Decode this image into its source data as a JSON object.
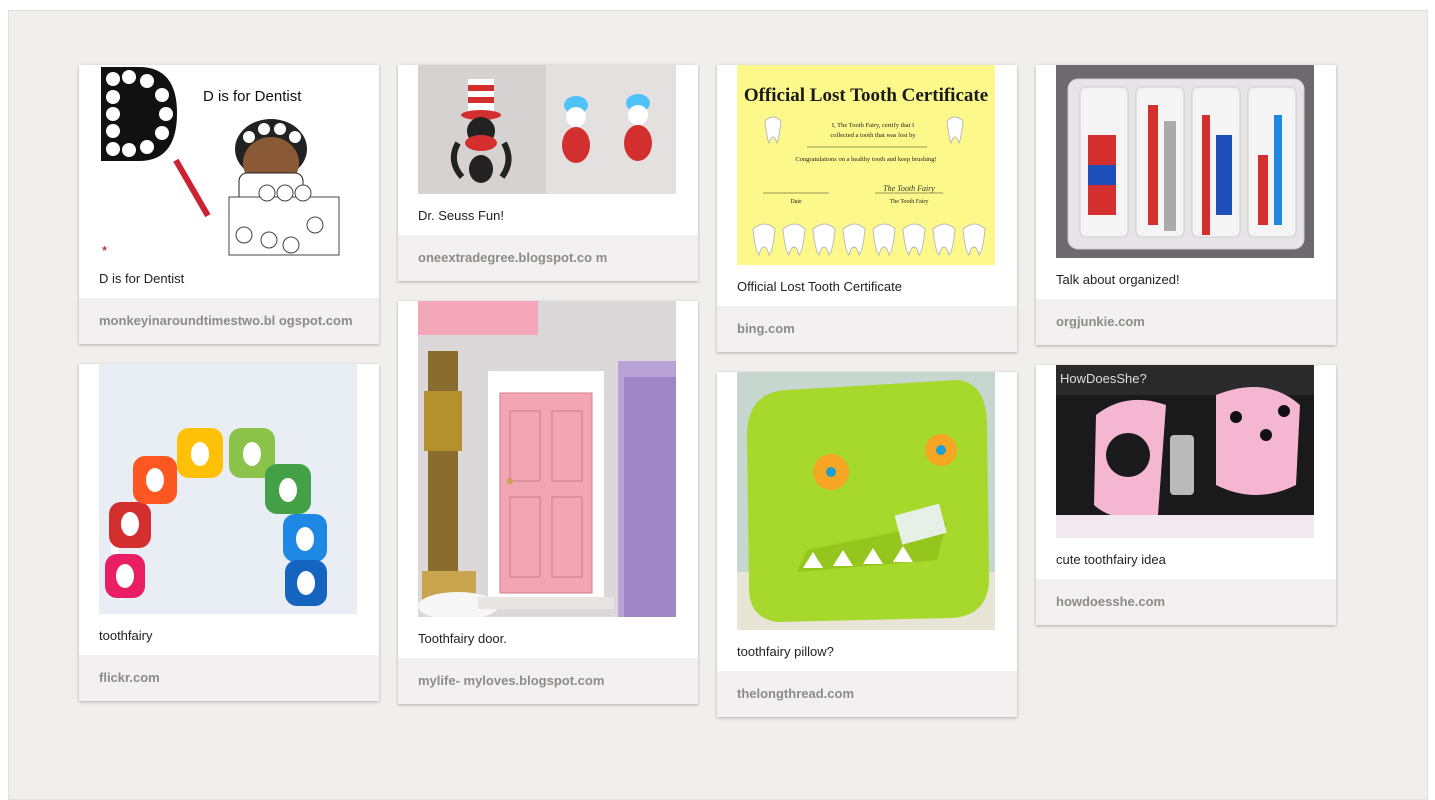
{
  "pins": [
    {
      "caption": "D is for Dentist",
      "source": "monkeyinaroundtimestwo.bl ogspot.com",
      "image_text": "D is for Dentist"
    },
    {
      "caption": "toothfairy",
      "source": "flickr.com"
    },
    {
      "caption": "Dr. Seuss Fun!",
      "source": "oneextradegree.blogspot.co m"
    },
    {
      "caption": "Toothfairy door.",
      "source": "mylife- myloves.blogspot.com"
    },
    {
      "caption": "Official Lost Tooth Certificate",
      "source": "bing.com",
      "image_text": {
        "title": "Official Lost Tooth Certificate",
        "line1": "I, The Tooth Fairy, certify that I",
        "line2": "collected a tooth that was lost by",
        "line3": "Congratulations on a healthy tooth and keep brushing!",
        "date_label": "Date",
        "sig": "The Tooth Fairy",
        "sig_label": "The Tooth Fairy"
      }
    },
    {
      "caption": "toothfairy pillow?",
      "source": "thelongthread.com"
    },
    {
      "caption": "Talk about organized!",
      "source": "orgjunkie.com"
    },
    {
      "caption": "cute toothfairy idea",
      "source": "howdoesshe.com",
      "image_text": "HowDoesShe?"
    }
  ]
}
